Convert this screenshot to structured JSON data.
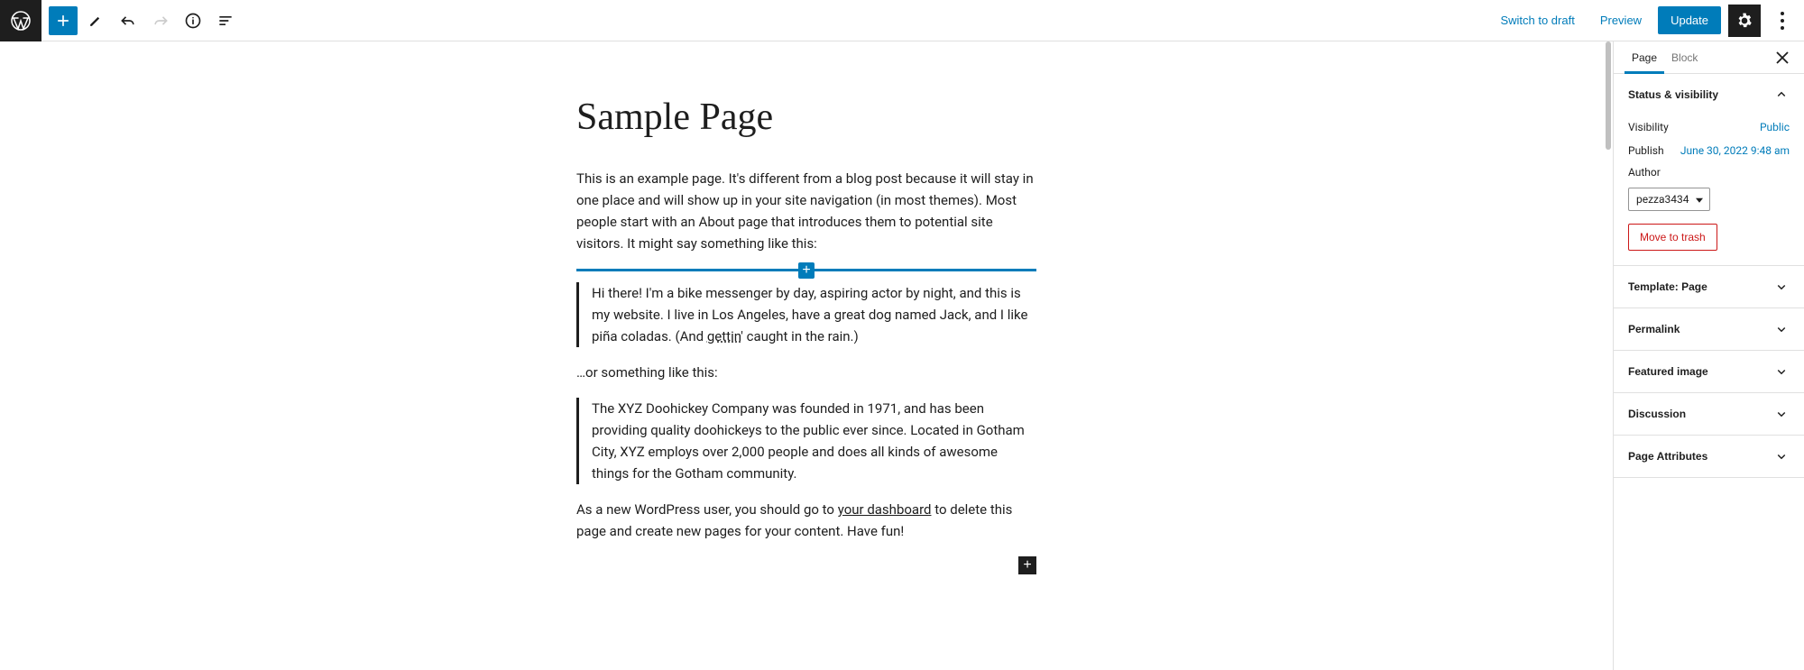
{
  "toolbar": {
    "switch_to_draft": "Switch to draft",
    "preview": "Preview",
    "update": "Update"
  },
  "editor": {
    "title": "Sample Page",
    "p1": "This is an example page. It's different from a blog post because it will stay in one place and will show up in your site navigation (in most themes). Most people start with an About page that introduces them to potential site visitors. It might say something like this:",
    "quote1_part1": "Hi there! I'm a bike messenger by day, aspiring actor by night, and this is my website. I live in Los Angeles, have a great dog named Jack, and I like piña coladas. (And ",
    "quote1_underlined": "gettin",
    "quote1_part2": "' caught in the rain.)",
    "p2": "…or something like this:",
    "quote2": "The XYZ Doohickey Company was founded in 1971, and has been providing quality doohickeys to the public ever since. Located in Gotham City, XYZ employs over 2,000 people and does all kinds of awesome things for the Gotham community.",
    "p3_part1": "As a new WordPress user, you should go to ",
    "p3_link": "your dashboard",
    "p3_part2": " to delete this page and create new pages for your content. Have fun!"
  },
  "sidebar": {
    "tabs": {
      "page": "Page",
      "block": "Block"
    },
    "status": {
      "header": "Status & visibility",
      "visibility_label": "Visibility",
      "visibility_value": "Public",
      "publish_label": "Publish",
      "publish_value": "June 30, 2022 9:48 am",
      "author_label": "Author",
      "author_value": "pezza3434",
      "trash": "Move to trash"
    },
    "panels": {
      "template": "Template: Page",
      "permalink": "Permalink",
      "featured_image": "Featured image",
      "discussion": "Discussion",
      "page_attributes": "Page Attributes"
    }
  }
}
